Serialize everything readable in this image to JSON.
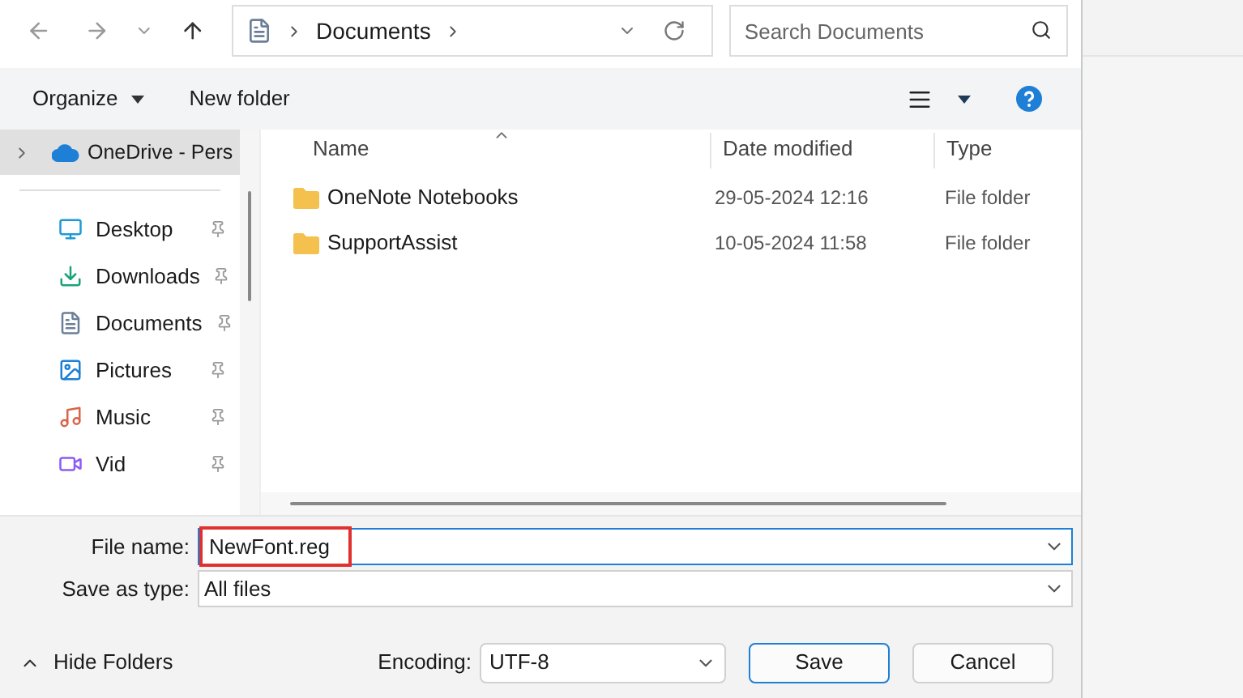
{
  "address_bar": {
    "path": [
      "Documents"
    ]
  },
  "search": {
    "placeholder": "Search Documents"
  },
  "toolbar": {
    "organize": "Organize",
    "new_folder": "New folder"
  },
  "sidebar": {
    "items": [
      {
        "label": "OneDrive - Pers",
        "kind": "cloud",
        "selected": true
      },
      {
        "label": "Desktop",
        "kind": "desktop",
        "selected": false,
        "pinned": true
      },
      {
        "label": "Downloads",
        "kind": "downloads",
        "selected": false,
        "pinned": true
      },
      {
        "label": "Documents",
        "kind": "documents",
        "selected": false,
        "pinned": true
      },
      {
        "label": "Pictures",
        "kind": "pictures",
        "selected": false,
        "pinned": true
      },
      {
        "label": "Music",
        "kind": "music",
        "selected": false,
        "pinned": true
      },
      {
        "label": "Vid",
        "kind": "videos",
        "selected": false,
        "pinned": true
      }
    ]
  },
  "table": {
    "columns": [
      "Name",
      "Date modified",
      "Type"
    ],
    "rows": [
      {
        "name": "OneNote Notebooks",
        "date": "29-05-2024 12:16",
        "type": "File folder"
      },
      {
        "name": "SupportAssist",
        "date": "10-05-2024 11:58",
        "type": "File folder"
      }
    ]
  },
  "file_name": {
    "label": "File name:",
    "value": "NewFont.reg"
  },
  "save_as_type": {
    "label": "Save as type:",
    "value": "All files"
  },
  "footer": {
    "hide_folders": "Hide Folders",
    "encoding_label": "Encoding:",
    "encoding": "UTF-8",
    "buttons": [
      "Save",
      "Cancel"
    ]
  }
}
